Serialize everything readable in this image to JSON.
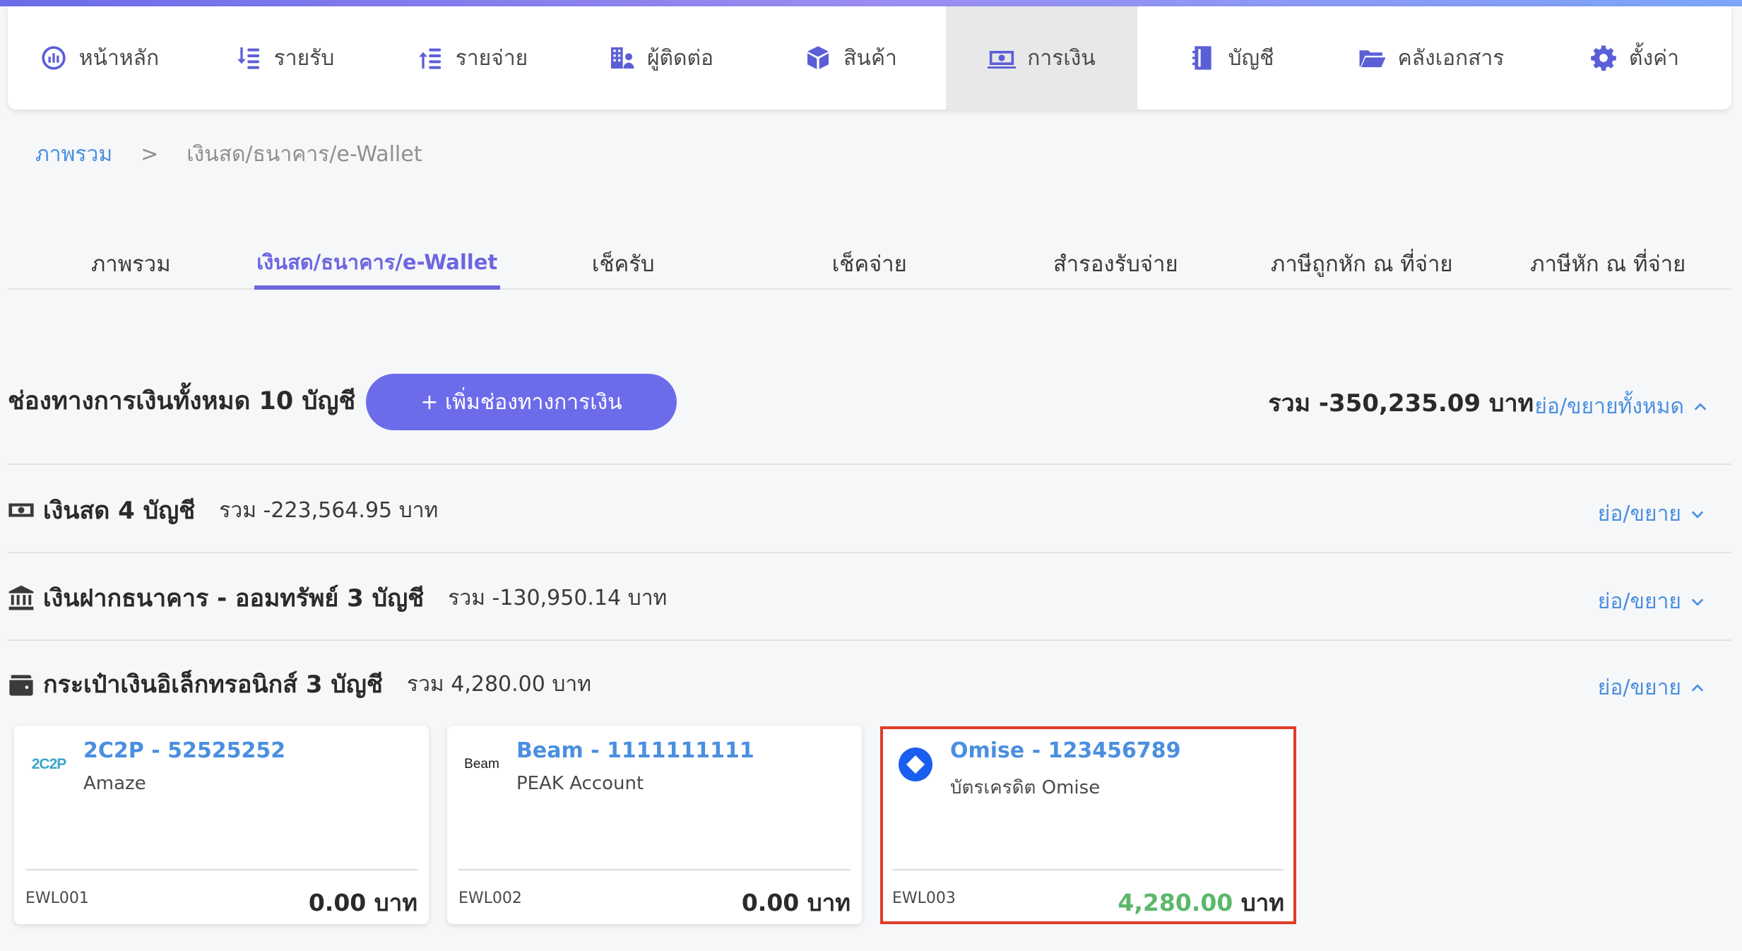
{
  "nav": {
    "items": [
      {
        "label": "หน้าหลัก",
        "icon": "dashboard-icon"
      },
      {
        "label": "รายรับ",
        "icon": "income-icon"
      },
      {
        "label": "รายจ่าย",
        "icon": "expense-icon"
      },
      {
        "label": "ผู้ติดต่อ",
        "icon": "contacts-icon"
      },
      {
        "label": "สินค้า",
        "icon": "box-icon"
      },
      {
        "label": "การเงิน",
        "icon": "money-icon",
        "active": true
      },
      {
        "label": "บัญชี",
        "icon": "ledger-icon"
      },
      {
        "label": "คลังเอกสาร",
        "icon": "folder-icon"
      },
      {
        "label": "ตั้งค่า",
        "icon": "gear-icon"
      }
    ]
  },
  "breadcrumb": {
    "root": "ภาพรวม",
    "separator": ">",
    "current": "เงินสด/ธนาคาร/e-Wallet"
  },
  "subtabs": [
    {
      "label": "ภาพรวม"
    },
    {
      "label": "เงินสด/ธนาคาร/e-Wallet",
      "active": true
    },
    {
      "label": "เช็ครับ"
    },
    {
      "label": "เช็คจ่าย"
    },
    {
      "label": "สำรองรับจ่าย"
    },
    {
      "label": "ภาษีถูกหัก ณ ที่จ่าย"
    },
    {
      "label": "ภาษีหัก ณ ที่จ่าย"
    }
  ],
  "summary": {
    "title": "ช่องทางการเงินทั้งหมด 10 บัญชี",
    "add_button": "+ เพิ่มช่องทางการเงิน",
    "total": "รวม -350,235.09 บาท",
    "toggle_all": "ย่อ/ขยายทั้งหมด"
  },
  "sections": [
    {
      "title": "เงินสด 4 บัญชี",
      "total": "รวม -223,564.95 บาท",
      "toggle": "ย่อ/ขยาย",
      "icon": "cash-icon"
    },
    {
      "title": "เงินฝากธนาคาร - ออมทรัพย์ 3 บัญชี",
      "total": "รวม -130,950.14 บาท",
      "toggle": "ย่อ/ขยาย",
      "icon": "bank-icon"
    },
    {
      "title": "กระเป๋าเงินอิเล็กทรอนิกส์ 3 บัญชี",
      "total": "รวม 4,280.00 บาท",
      "toggle": "ย่อ/ขยาย",
      "icon": "wallet-icon"
    }
  ],
  "cards": [
    {
      "logo_text": "2C2P",
      "name": "2C2P - 52525252",
      "subtitle": "Amaze",
      "code": "EWL001",
      "amount": "0.00",
      "unit": "บาท",
      "positive": false
    },
    {
      "logo_text": "Beam",
      "name": "Beam - 1111111111",
      "subtitle": "PEAK Account",
      "code": "EWL002",
      "amount": "0.00",
      "unit": "บาท",
      "positive": false
    },
    {
      "logo_text": "",
      "name": "Omise - 123456789",
      "subtitle": "บัตรเครดิต Omise",
      "code": "EWL003",
      "amount": "4,280.00",
      "unit": "บาท",
      "positive": true
    }
  ],
  "colors": {
    "accent": "#6c6ceb",
    "link": "#4a8fe0",
    "positive": "#5bb86b",
    "highlight": "#e13c2a"
  }
}
